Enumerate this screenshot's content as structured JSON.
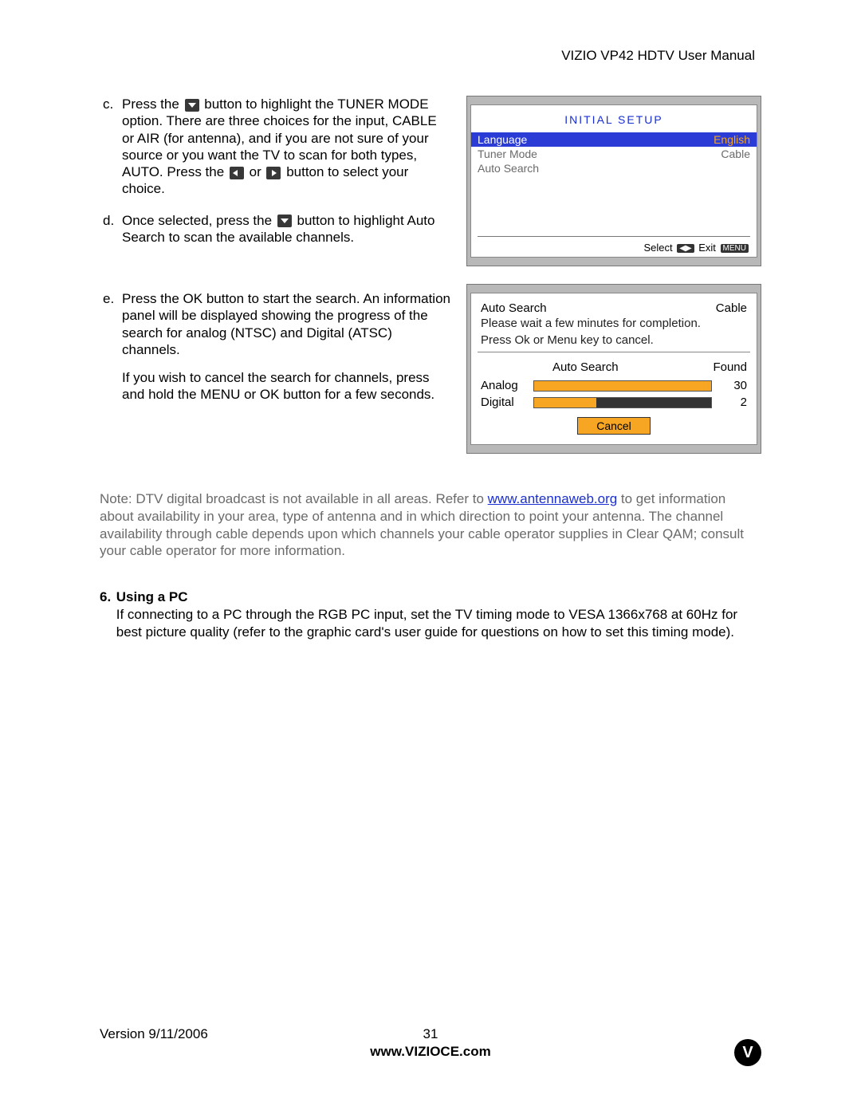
{
  "header": {
    "title": "VIZIO VP42 HDTV User Manual"
  },
  "steps": {
    "c": {
      "marker": "c.",
      "part1": "Press the ",
      "part2": " button to highlight the TUNER MODE option.  There are three choices for the input, CABLE or AIR (for antenna), and if you are not sure of your source or you want the TV to scan for both types, AUTO.  Press the ",
      "part3": " or ",
      "part4": " button to select your choice."
    },
    "d": {
      "marker": "d.",
      "part1": "Once selected, press the ",
      "part2": " button to highlight Auto Search to scan the available channels."
    },
    "e": {
      "marker": "e.",
      "p1": "Press the OK button to start the search.  An information panel will be displayed showing the progress of the search for analog (NTSC) and Digital (ATSC) channels.",
      "p2": "If you wish to cancel the search for channels, press and hold the MENU or OK button for a few seconds."
    }
  },
  "osd1": {
    "title": "INITIAL  SETUP",
    "rows": [
      {
        "label": "Language",
        "value": "English",
        "highlight": true
      },
      {
        "label": "Tuner  Mode",
        "value": "Cable",
        "highlight": false
      },
      {
        "label": "Auto  Search",
        "value": "",
        "highlight": false
      }
    ],
    "footer_select": "Select",
    "footer_exit": "Exit",
    "footer_menu": "MENU"
  },
  "osd2": {
    "title": "Auto  Search",
    "mode": "Cable",
    "msg1": "Please  wait  a  few  minutes  for  completion.",
    "msg2": "Press  Ok  or  Menu  key  to  cancel.",
    "col_mid": "Auto  Search",
    "col_right": "Found",
    "rows": [
      {
        "label": "Analog",
        "found": "30",
        "pct": 100
      },
      {
        "label": "Digital",
        "found": "2",
        "pct": 35
      }
    ],
    "cancel": "Cancel"
  },
  "note": {
    "pre": "Note: DTV digital broadcast is not available in all areas.  Refer to ",
    "link": "www.antennaweb.org",
    "post": " to get information about availability in your area, type of antenna and in which direction to point your antenna.  The channel availability through cable depends upon which channels your cable operator supplies in Clear QAM; consult your cable operator for more information."
  },
  "section6": {
    "marker": "6.",
    "title": "Using a PC",
    "body": "If connecting to a PC through the RGB PC input, set the TV timing mode to VESA 1366x768 at 60Hz for best picture quality (refer to the graphic card's user guide for questions on how to set this timing mode)."
  },
  "footer": {
    "version": "Version 9/11/2006",
    "page": "31",
    "url": "www.VIZIOCE.com",
    "logo": "V"
  }
}
